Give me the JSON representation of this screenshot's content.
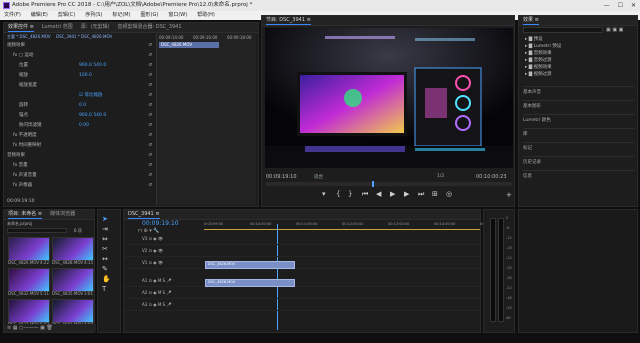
{
  "window": {
    "title": "Adobe Premiere Pro CC 2018 - C:\\用户\\ZOL\\文档\\Adobe\\Premiere Pro\\12.0\\未命名.prproj *",
    "min": "—",
    "max": "☐",
    "close": "✕"
  },
  "menu": [
    "文件(F)",
    "编辑(E)",
    "剪辑(C)",
    "序列(S)",
    "标记(M)",
    "图形(G)",
    "窗口(W)",
    "帮助(H)"
  ],
  "source_panel": {
    "tabs": [
      "效果控件 ≡",
      "Lumetri 范围",
      "源：(无剪辑)",
      "音频剪辑混合器: DSC_3941"
    ],
    "breadcrumb_a": "主要 * DSC_4826.MOV",
    "breadcrumb_b": "DSC_3941 * DSC_4826.MOV",
    "timecodes": [
      "00:09:14:00",
      "00:09:16:00",
      "00:09:18:00"
    ],
    "clip_chip": "DSC_4826.MOV",
    "rows": [
      {
        "label": "视频效果",
        "value": "",
        "indent": 0
      },
      {
        "label": "fx □ 运动",
        "value": "",
        "indent": 1
      },
      {
        "label": "位置",
        "value": "960.0   540.0",
        "indent": 2
      },
      {
        "label": "缩放",
        "value": "100.0",
        "indent": 2
      },
      {
        "label": "缩放宽度",
        "value": "",
        "indent": 2
      },
      {
        "label": "",
        "value": "☑ 等比缩放",
        "indent": 3
      },
      {
        "label": "旋转",
        "value": "0.0",
        "indent": 2
      },
      {
        "label": "锚点",
        "value": "960.0   540.0",
        "indent": 2
      },
      {
        "label": "防闪烁滤镜",
        "value": "0.00",
        "indent": 2
      },
      {
        "label": "fx 不透明度",
        "value": "",
        "indent": 1
      },
      {
        "label": "fx 时间重映射",
        "value": "",
        "indent": 1
      },
      {
        "label": "音频效果",
        "value": "",
        "indent": 0
      },
      {
        "label": "fx 音量",
        "value": "",
        "indent": 1
      },
      {
        "label": "fx 声道音量",
        "value": "",
        "indent": 1
      },
      {
        "label": "fx 声像器",
        "value": "",
        "indent": 1
      }
    ],
    "bottom_tc": "00:09:19:10"
  },
  "program": {
    "tab": "节目: DSC_3941 ≡",
    "timecode": "00:09:19:10",
    "fit": "适合",
    "ratio": "1/2",
    "duration": "00:10:00:23",
    "playhead_pct": 43
  },
  "effects": {
    "tab": "效果 ≡",
    "items": [
      "预设",
      "Lumetri 预设",
      "音频效果",
      "音频过渡",
      "视频效果",
      "视频过渡"
    ],
    "panels": [
      "基本声音",
      "基本图形",
      "Lumetri 颜色",
      "库",
      "标记",
      "历史记录",
      "信息"
    ]
  },
  "project": {
    "tabs": [
      "项目: 未命名 ≡",
      "媒体浏览器"
    ],
    "filename": "未命名.prproj",
    "count": "6 项",
    "clips": [
      {
        "name": "DSC_4826.MOV",
        "dur": "4:22"
      },
      {
        "name": "DSC_4828.MOV",
        "dur": "4:15"
      },
      {
        "name": "DSC_4832.MOV",
        "dur": "5:11"
      },
      {
        "name": "DSC_4835.MOV",
        "dur": "3:01"
      },
      {
        "name": "DSC_4837.MOV",
        "dur": "6:02"
      },
      {
        "name": "DSC_4841.MOV",
        "dur": "4:09"
      }
    ]
  },
  "timeline": {
    "tab": "DSC_3941 ≡",
    "timecode": "00:09:19:10",
    "ruler": [
      "0:00:59:00",
      "00:10:00:00",
      "00:11:00:00",
      "00:12:00:00",
      "00:13:00:00",
      "00:14:00:00",
      "00:15:00:00"
    ],
    "video_tracks": [
      "V3",
      "V2",
      "V1"
    ],
    "audio_tracks": [
      "A1",
      "A2",
      "A3"
    ],
    "clip_label": "DSC_4826.MOV",
    "meter_labels": [
      "0",
      "-6",
      "-12",
      "-18",
      "-24",
      "-30",
      "-36",
      "-42",
      "-48",
      "-54",
      "dB"
    ]
  }
}
